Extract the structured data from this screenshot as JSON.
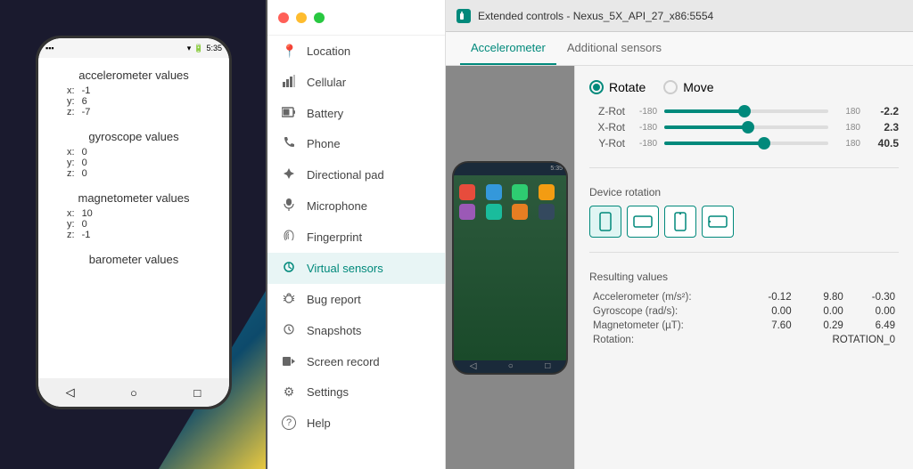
{
  "window": {
    "title": "Extended controls - Nexus_5X_API_27_x86:5554",
    "icon": "phone-icon"
  },
  "phone": {
    "time": "5:35",
    "sensors": [
      {
        "name": "accelerometer values",
        "values": [
          {
            "axis": "x:",
            "val": "-1"
          },
          {
            "axis": "y:",
            "val": "6"
          },
          {
            "axis": "z:",
            "val": "-7"
          }
        ]
      },
      {
        "name": "gyroscope values",
        "values": [
          {
            "axis": "x:",
            "val": "0"
          },
          {
            "axis": "y:",
            "val": "0"
          },
          {
            "axis": "z:",
            "val": "0"
          }
        ]
      },
      {
        "name": "magnetometer values",
        "values": [
          {
            "axis": "x:",
            "val": "10"
          },
          {
            "axis": "y:",
            "val": "0"
          },
          {
            "axis": "z:",
            "val": "-1"
          }
        ]
      },
      {
        "name": "barometer values",
        "values": []
      }
    ]
  },
  "sidebar": {
    "items": [
      {
        "id": "location",
        "label": "Location",
        "icon": "📍"
      },
      {
        "id": "cellular",
        "label": "Cellular",
        "icon": "📶"
      },
      {
        "id": "battery",
        "label": "Battery",
        "icon": "🔋"
      },
      {
        "id": "phone",
        "label": "Phone",
        "icon": "📞"
      },
      {
        "id": "directional",
        "label": "Directional pad",
        "icon": "◈"
      },
      {
        "id": "microphone",
        "label": "Microphone",
        "icon": "🎤"
      },
      {
        "id": "fingerprint",
        "label": "Fingerprint",
        "icon": "👆"
      },
      {
        "id": "virtual-sensors",
        "label": "Virtual sensors",
        "icon": "⟳"
      },
      {
        "id": "bug-report",
        "label": "Bug report",
        "icon": "🐞"
      },
      {
        "id": "snapshots",
        "label": "Snapshots",
        "icon": "🕐"
      },
      {
        "id": "screen-record",
        "label": "Screen record",
        "icon": "🎬"
      },
      {
        "id": "settings",
        "label": "Settings",
        "icon": "⚙"
      },
      {
        "id": "help",
        "label": "Help",
        "icon": "?"
      }
    ],
    "active_item": "virtual-sensors"
  },
  "tabs": [
    {
      "id": "accelerometer",
      "label": "Accelerometer"
    },
    {
      "id": "additional",
      "label": "Additional sensors"
    }
  ],
  "active_tab": "accelerometer",
  "controls": {
    "mode": {
      "rotate_label": "Rotate",
      "move_label": "Move",
      "selected": "rotate"
    },
    "sliders": [
      {
        "id": "z-rot",
        "label": "Z-Rot",
        "min": -180,
        "max": 180,
        "value": -2.2,
        "fill_pct": 49,
        "thumb_pct": 49
      },
      {
        "id": "x-rot",
        "label": "X-Rot",
        "min": -180,
        "max": 180,
        "value": 2.3,
        "fill_pct": 51,
        "thumb_pct": 51
      },
      {
        "id": "y-rot",
        "label": "Y-Rot",
        "min": -180,
        "max": 180,
        "value": 40.5,
        "fill_pct": 61,
        "thumb_pct": 61
      }
    ],
    "device_rotation": {
      "title": "Device rotation",
      "buttons": [
        {
          "id": "portrait",
          "icon": "portrait"
        },
        {
          "id": "landscape",
          "icon": "landscape"
        },
        {
          "id": "portrait-rev",
          "icon": "portrait-rev"
        },
        {
          "id": "landscape-rev",
          "icon": "landscape-rev"
        }
      ],
      "active": "portrait"
    },
    "resulting_values": {
      "title": "Resulting values",
      "rows": [
        {
          "label": "Accelerometer (m/s²):",
          "v1": "-0.12",
          "v2": "9.80",
          "v3": "-0.30"
        },
        {
          "label": "Gyroscope (rad/s):",
          "v1": "0.00",
          "v2": "0.00",
          "v3": "0.00"
        },
        {
          "label": "Magnetometer (µT):",
          "v1": "7.60",
          "v2": "0.29",
          "v3": "6.49"
        },
        {
          "label": "Rotation:",
          "v1": "ROTATION_0",
          "v2": "",
          "v3": ""
        }
      ]
    }
  }
}
